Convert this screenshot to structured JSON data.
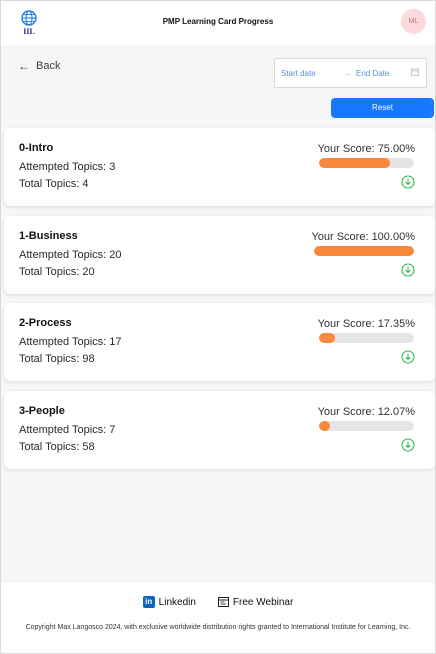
{
  "header": {
    "logo_text": "IIL",
    "title": "PMP Learning Card Progress",
    "avatar_initials": "ML"
  },
  "toolbar": {
    "back_label": "Back",
    "start_date_placeholder": "Start date",
    "end_date_placeholder": "End Date",
    "reset_label": "Reset"
  },
  "cards": [
    {
      "title": "0-Intro",
      "attempted": "Attempted Topics: 3",
      "total": "Total Topics: 4",
      "score_text": "Your Score: 75.00%",
      "score_pct": 75.0
    },
    {
      "title": "1-Business",
      "attempted": "Attempted Topics: 20",
      "total": "Total Topics: 20",
      "score_text": "Your Score: 100.00%",
      "score_pct": 100.0
    },
    {
      "title": "2-Process",
      "attempted": "Attempted Topics: 17",
      "total": "Total Topics: 98",
      "score_text": "Your Score: 17.35%",
      "score_pct": 17.35
    },
    {
      "title": "3-People",
      "attempted": "Attempted Topics: 7",
      "total": "Total Topics: 58",
      "score_text": "Your Score: 12.07%",
      "score_pct": 12.07
    }
  ],
  "footer": {
    "linkedin_label": "Linkedin",
    "webinar_label": "Free Webinar",
    "copyright": "Copyright Max Langosco 2024, with exclusive worldwide distribution rights granted to International Institute for Learning, Inc."
  },
  "colors": {
    "primary": "#1677ff",
    "progress": "#f7883c",
    "track": "#e5e5e5",
    "success": "#2fb84f",
    "linkedin": "#0a66c2"
  },
  "icons": [
    "globe-logo-icon",
    "arrow-left-icon",
    "arrow-right-icon",
    "calendar-icon",
    "download-circle-icon",
    "linkedin-icon",
    "webinar-icon"
  ]
}
